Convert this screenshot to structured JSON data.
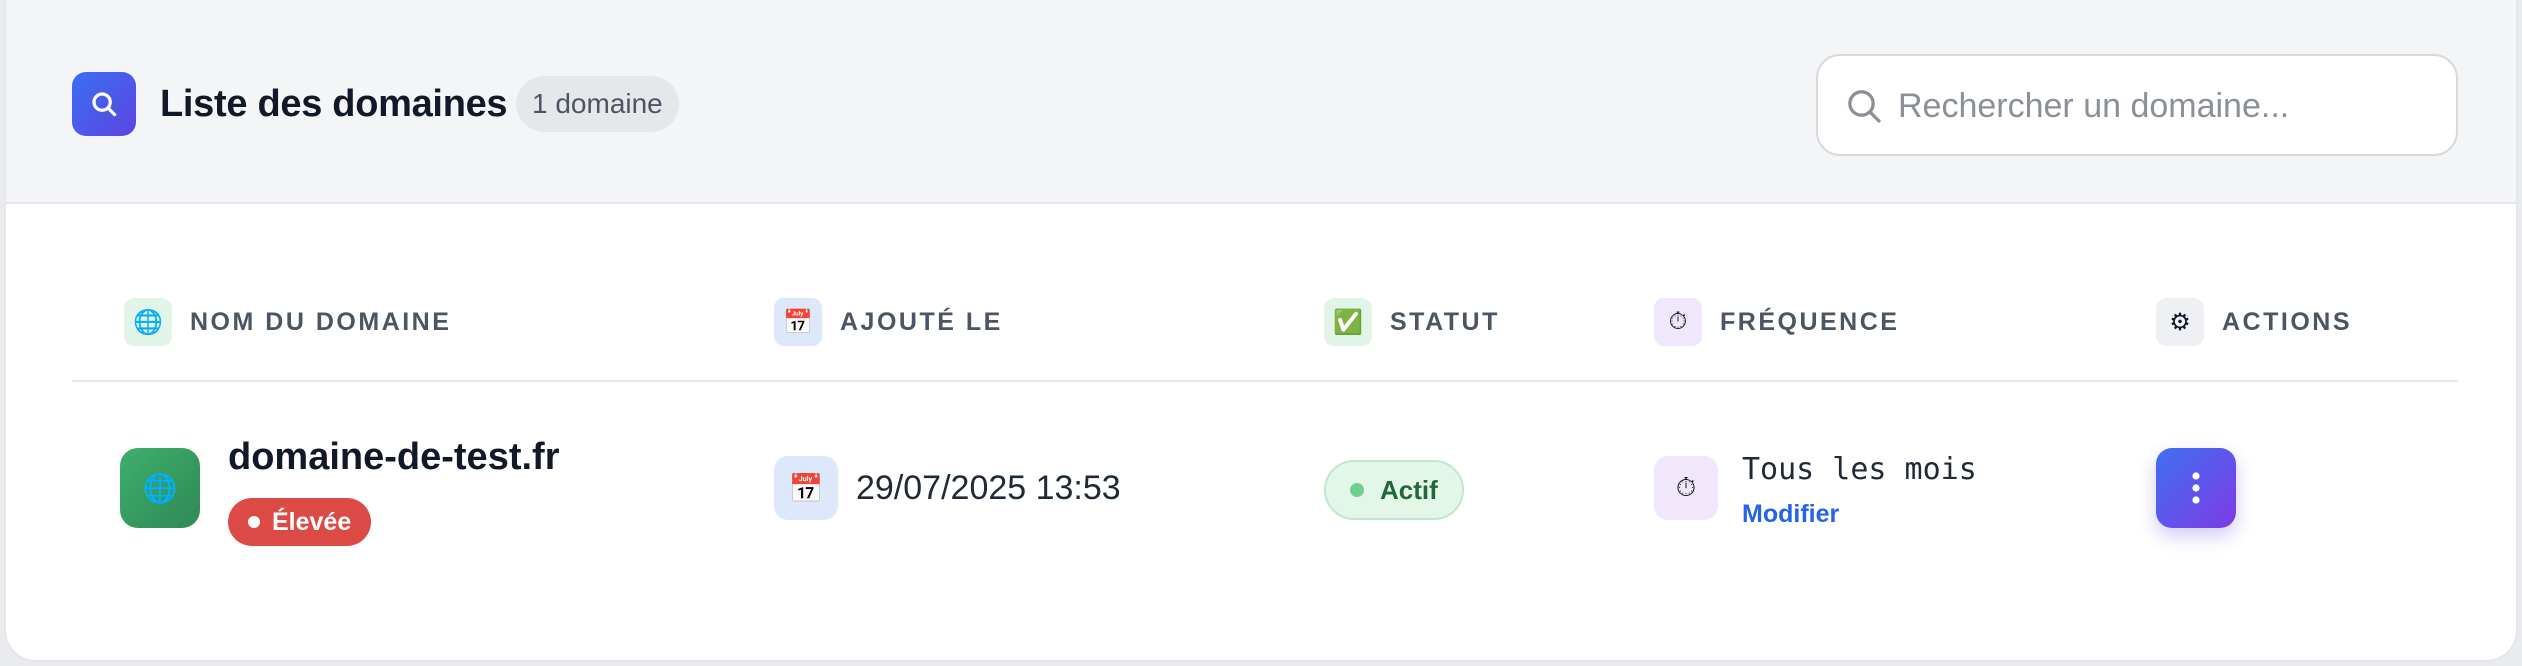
{
  "header": {
    "icon": "search-icon",
    "title": "Liste des domaines",
    "count_badge": "1 domaine",
    "search": {
      "placeholder": "Rechercher un domaine...",
      "value": ""
    }
  },
  "columns": [
    {
      "label": "NOM DU DOMAINE",
      "icon": "globe-icon",
      "icon_glyph": "🌐",
      "icon_bg": "#e2f4e8"
    },
    {
      "label": "AJOUTÉ LE",
      "icon": "calendar-icon",
      "icon_glyph": "📅",
      "icon_bg": "#dde8fb"
    },
    {
      "label": "STATUT",
      "icon": "check-icon",
      "icon_glyph": "✅",
      "icon_bg": "#e2f4e8"
    },
    {
      "label": "FRÉQUENCE",
      "icon": "stopwatch-icon",
      "icon_glyph": "⏱",
      "icon_bg": "#f1e7fb"
    },
    {
      "label": "ACTIONS",
      "icon": "gear-icon",
      "icon_glyph": "⚙",
      "icon_bg": "#eef0f3"
    }
  ],
  "rows": [
    {
      "domain": "domaine-de-test.fr",
      "domain_icon": "globe-icon",
      "priority": "Élevée",
      "added_on": "29/07/2025 13:53",
      "status": "Actif",
      "frequency": "Tous les mois",
      "frequency_action": "Modifier",
      "actions_icon": "more-vertical-icon"
    }
  ],
  "colors": {
    "accent": "#4f5ee8",
    "priority_high": "#dc4a46",
    "status_active": "#22673a",
    "link": "#2563eb"
  }
}
